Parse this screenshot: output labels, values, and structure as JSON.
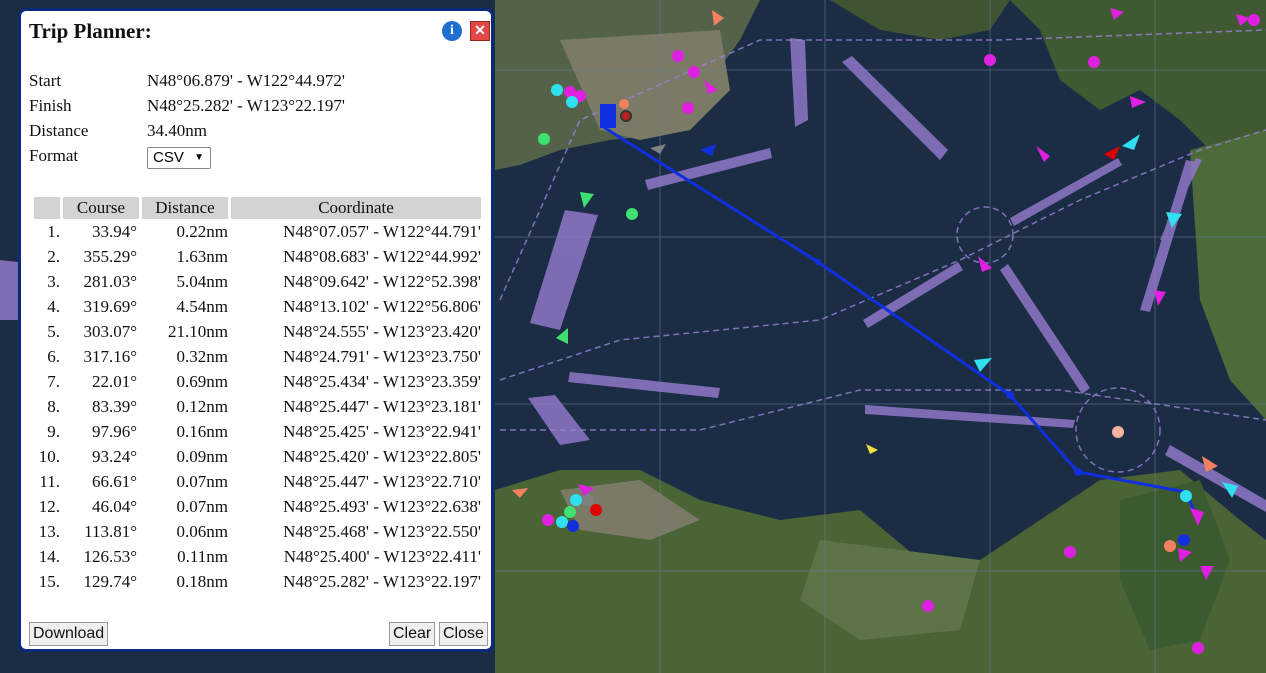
{
  "planner": {
    "title": "Trip Planner:",
    "info_icon": "info-icon",
    "close_icon": "close-icon",
    "start_label": "Start",
    "start_value": "N48°06.879' - W122°44.972'",
    "finish_label": "Finish",
    "finish_value": "N48°25.282' - W123°22.197'",
    "distance_label": "Distance",
    "distance_value": "34.40nm",
    "format_label": "Format",
    "format_value": "CSV",
    "columns": [
      "Course",
      "Distance",
      "Coordinate"
    ],
    "legs": [
      {
        "idx": "1.",
        "course": "33.94°",
        "distance": "0.22nm",
        "coordinate": "N48°07.057' - W122°44.791'"
      },
      {
        "idx": "2.",
        "course": "355.29°",
        "distance": "1.63nm",
        "coordinate": "N48°08.683' - W122°44.992'"
      },
      {
        "idx": "3.",
        "course": "281.03°",
        "distance": "5.04nm",
        "coordinate": "N48°09.642' - W122°52.398'"
      },
      {
        "idx": "4.",
        "course": "319.69°",
        "distance": "4.54nm",
        "coordinate": "N48°13.102' - W122°56.806'"
      },
      {
        "idx": "5.",
        "course": "303.07°",
        "distance": "21.10nm",
        "coordinate": "N48°24.555' - W123°23.420'"
      },
      {
        "idx": "6.",
        "course": "317.16°",
        "distance": "0.32nm",
        "coordinate": "N48°24.791' - W123°23.750'"
      },
      {
        "idx": "7.",
        "course": "22.01°",
        "distance": "0.69nm",
        "coordinate": "N48°25.434' - W123°23.359'"
      },
      {
        "idx": "8.",
        "course": "83.39°",
        "distance": "0.12nm",
        "coordinate": "N48°25.447' - W123°23.181'"
      },
      {
        "idx": "9.",
        "course": "97.96°",
        "distance": "0.16nm",
        "coordinate": "N48°25.425' - W123°22.941'"
      },
      {
        "idx": "10.",
        "course": "93.24°",
        "distance": "0.09nm",
        "coordinate": "N48°25.420' - W123°22.805'"
      },
      {
        "idx": "11.",
        "course": "66.61°",
        "distance": "0.07nm",
        "coordinate": "N48°25.447' - W123°22.710'"
      },
      {
        "idx": "12.",
        "course": "46.04°",
        "distance": "0.07nm",
        "coordinate": "N48°25.493' - W123°22.638'"
      },
      {
        "idx": "13.",
        "course": "113.81°",
        "distance": "0.06nm",
        "coordinate": "N48°25.468' - W123°22.550'"
      },
      {
        "idx": "14.",
        "course": "126.53°",
        "distance": "0.11nm",
        "coordinate": "N48°25.400' - W123°22.411'"
      },
      {
        "idx": "15.",
        "course": "129.74°",
        "distance": "0.18nm",
        "coordinate": "N48°25.282' - W123°22.197'"
      }
    ],
    "download_label": "Download",
    "clear_label": "Clear",
    "close_label": "Close"
  },
  "colors": {
    "water": "#1b2c45",
    "land": "#3f5a33",
    "route": "#1030e0",
    "traffic_lane": "#8f78c8",
    "panel_border": "#0b2a7a"
  }
}
